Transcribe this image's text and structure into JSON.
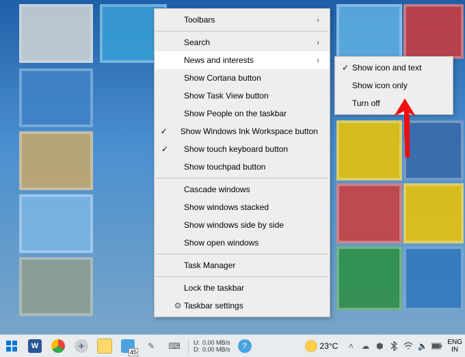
{
  "context_menu": {
    "items": [
      {
        "label": "Toolbars",
        "submenu": true,
        "checked": false,
        "icon": null
      },
      {
        "label": "Search",
        "submenu": true,
        "checked": false,
        "icon": null
      },
      {
        "label": "News and interests",
        "submenu": true,
        "checked": false,
        "icon": null,
        "hover": true
      },
      {
        "label": "Show Cortana button",
        "submenu": false,
        "checked": false,
        "icon": null
      },
      {
        "label": "Show Task View button",
        "submenu": false,
        "checked": false,
        "icon": null
      },
      {
        "label": "Show People on the taskbar",
        "submenu": false,
        "checked": false,
        "icon": null
      },
      {
        "label": "Show Windows Ink Workspace button",
        "submenu": false,
        "checked": true,
        "icon": null
      },
      {
        "label": "Show touch keyboard button",
        "submenu": false,
        "checked": true,
        "icon": null
      },
      {
        "label": "Show touchpad button",
        "submenu": false,
        "checked": false,
        "icon": null
      },
      {
        "label": "Cascade windows",
        "submenu": false,
        "checked": false,
        "icon": null
      },
      {
        "label": "Show windows stacked",
        "submenu": false,
        "checked": false,
        "icon": null
      },
      {
        "label": "Show windows side by side",
        "submenu": false,
        "checked": false,
        "icon": null
      },
      {
        "label": "Show open windows",
        "submenu": false,
        "checked": false,
        "icon": null
      },
      {
        "label": "Task Manager",
        "submenu": false,
        "checked": false,
        "icon": null
      },
      {
        "label": "Lock the taskbar",
        "submenu": false,
        "checked": false,
        "icon": null
      },
      {
        "label": "Taskbar settings",
        "submenu": false,
        "checked": false,
        "icon": "gear"
      }
    ]
  },
  "submenu": {
    "items": [
      {
        "label": "Show icon and text",
        "checked": true
      },
      {
        "label": "Show icon only",
        "checked": false
      },
      {
        "label": "Turn off",
        "checked": false
      }
    ]
  },
  "taskbar": {
    "net": {
      "u_label": "U:",
      "d_label": "D:",
      "u_val": "0.00 MB/s",
      "d_val": "0.00 MB/s"
    },
    "weather_temp": "23°C",
    "lang_top": "ENG",
    "lang_bot": "IN",
    "badge": "45"
  }
}
